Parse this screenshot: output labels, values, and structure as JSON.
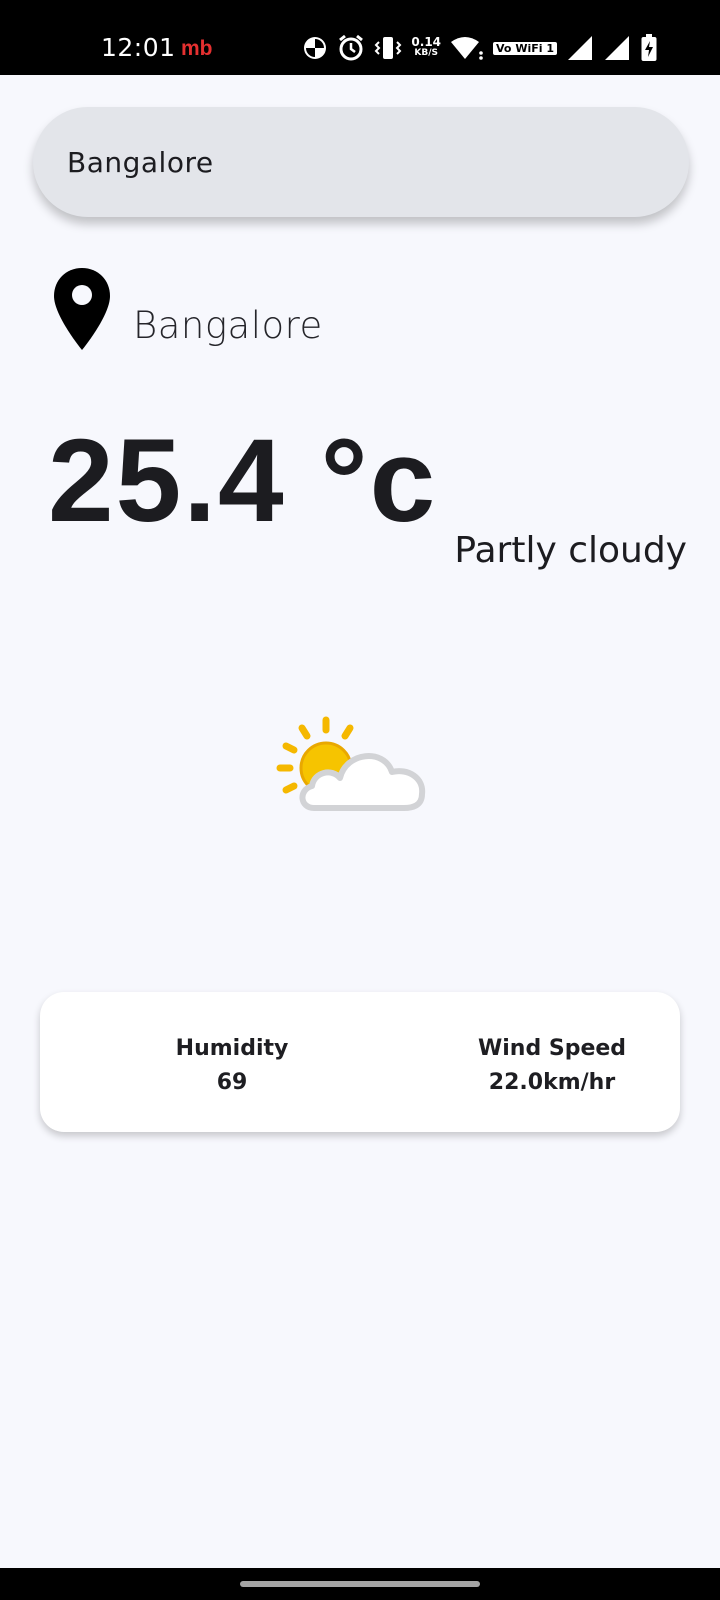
{
  "status_bar": {
    "time": "12:01",
    "carrier_badge": "mb",
    "net_speed_value": "0.14",
    "net_speed_unit": "KB/S",
    "vowifi_label": "Vo WiFi 1",
    "icons": [
      "vpn-icon",
      "alarm-icon",
      "vibrate-icon",
      "wifi-icon",
      "signal-icon",
      "signal-icon",
      "battery-charging-icon"
    ]
  },
  "search": {
    "value": "Bangalore"
  },
  "location": {
    "name": "Bangalore",
    "icon": "location-pin-icon"
  },
  "weather": {
    "temperature": "25.4 °c",
    "condition": "Partly cloudy",
    "icon": "partly-cloudy-icon"
  },
  "details": {
    "humidity_label": "Humidity",
    "humidity_value": "69",
    "wind_label": "Wind Speed",
    "wind_value": "22.0km/hr"
  },
  "colors": {
    "background": "#f7f8fd",
    "search_bg": "#e3e5ea",
    "card_bg": "#ffffff",
    "text": "#1c1c20",
    "sun": "#f5b800",
    "carrier": "#e53030"
  }
}
